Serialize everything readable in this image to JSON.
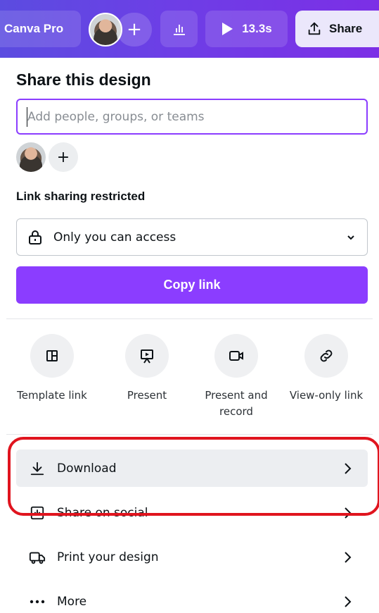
{
  "topbar": {
    "pro_label": "Canva Pro",
    "add_icon": "plus-icon",
    "insights_icon": "bar-chart-icon",
    "present_time": "13.3s",
    "share_label": "Share"
  },
  "panel": {
    "title": "Share this design",
    "people_input_placeholder": "Add people, groups, or teams",
    "link_section_label": "Link sharing restricted",
    "access_value": "Only you can access",
    "copy_link_label": "Copy link"
  },
  "actions": [
    {
      "label": "Template link",
      "icon": "template-icon"
    },
    {
      "label": "Present",
      "icon": "presentation-icon"
    },
    {
      "label": "Present and record",
      "icon": "video-camera-icon"
    },
    {
      "label": "View-only link",
      "icon": "link-icon"
    }
  ],
  "options": [
    {
      "label": "Download",
      "icon": "download-icon"
    },
    {
      "label": "Share on social",
      "icon": "share-social-icon"
    },
    {
      "label": "Print your design",
      "icon": "truck-icon"
    },
    {
      "label": "More",
      "icon": "more-icon"
    }
  ],
  "colors": {
    "brand": "#8b3dff",
    "highlight": "#e0141e"
  }
}
